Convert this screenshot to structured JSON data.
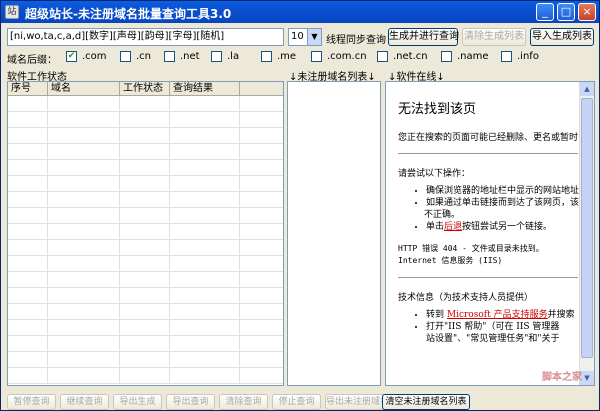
{
  "window": {
    "title": "超级站长-未注册域名批量查询工具3.0",
    "icon_text": "站",
    "min": "_",
    "max": "□",
    "close": "×"
  },
  "toolbar": {
    "pattern_value": "[ni,wo,ta,c,a,d][数字][声母][韵母][字母][随机]",
    "thread_count": "10",
    "thread_label": "线程同步查询",
    "generate_query": "生成并进行查询",
    "clear_list": "清除生成列表",
    "import_list": "导入生成列表"
  },
  "suffix": {
    "label": "域名后缀：",
    "items": [
      {
        "name": ".com",
        "checked": true
      },
      {
        "name": ".cn",
        "checked": false
      },
      {
        "name": ".net",
        "checked": false
      },
      {
        "name": ".la",
        "checked": false
      },
      {
        "name": ".me",
        "checked": false
      },
      {
        "name": ".com.cn",
        "checked": false
      },
      {
        "name": ".net.cn",
        "checked": false
      },
      {
        "name": ".name",
        "checked": false
      },
      {
        "name": ".info",
        "checked": false
      }
    ]
  },
  "sections": {
    "status": "软件工作状态",
    "unregistered": "↓未注册域名列表↓",
    "online": "↓软件在线↓"
  },
  "grid": {
    "columns": [
      "序号",
      "域名",
      "工作状态",
      "查询结果"
    ]
  },
  "error_page": {
    "heading": "无法找到该页",
    "desc": "您正在搜索的页面可能已经删除、更名或暂时",
    "try": "请尝试以下操作：",
    "bullets": [
      "确保浏览器的地址栏中显示的网站地址",
      "如果通过单击链接而到达了该网页，该",
      "单击后退按钮尝试另一个链接。"
    ],
    "bullet2_cont": "不正确。",
    "back_link": "后退",
    "http1": "HTTP 错误 404 - 文件或目录未找到。",
    "http2": "Internet 信息服务 (IIS)",
    "tech": "技术信息（为技术支持人员提供）",
    "tech_bullets": [
      "转到 Microsoft 产品支持服务并搜索",
      "打开\"IIS 帮助\"（可在 IIS 管理器",
      "站设置\"、\"常见管理任务\"和\"关于"
    ],
    "ms_link": "Microsoft 产品支持服务",
    "watermark": "脚本之家"
  },
  "bottom": {
    "buttons": [
      "暂停查询",
      "继续查询",
      "导出生成",
      "导出查询",
      "清除查询",
      "停止查询",
      "导出未注册域名"
    ],
    "clear_unregistered": "清空未注册域名列表"
  }
}
